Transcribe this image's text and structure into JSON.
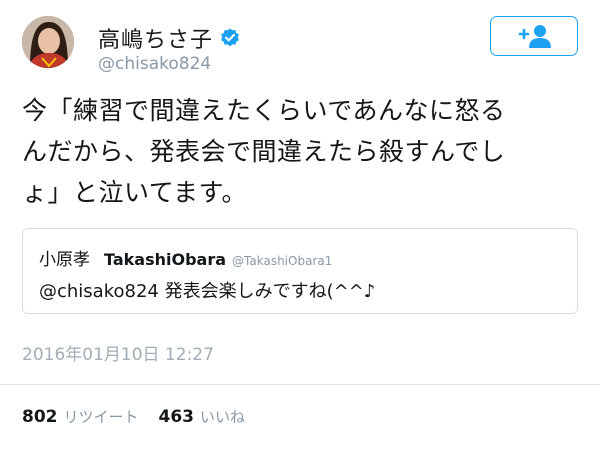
{
  "user": {
    "display_name": "高嶋ちさ子",
    "handle": "@chisako824"
  },
  "follow_button": {
    "icon": "add-user-icon",
    "color": "#1da1f2"
  },
  "tweet": {
    "lines": [
      "今「練習で間違えたくらいであんなに怒る",
      "んだから、発表会で間違えたら殺すんでし",
      "ょ」と泣いてます。"
    ]
  },
  "quote": {
    "name": "小原孝",
    "name_en": "TakashiObara",
    "handle": "@TakashiObara1",
    "text": "@chisako824 発表会楽しみですね(^^♪"
  },
  "timestamp": "2016年01月10日 12:27",
  "stats": {
    "retweets": "802",
    "retweets_label": "リツイート",
    "likes": "463",
    "likes_label": "いいね"
  },
  "colors": {
    "accent": "#1da1f2",
    "muted": "#8899a6"
  }
}
